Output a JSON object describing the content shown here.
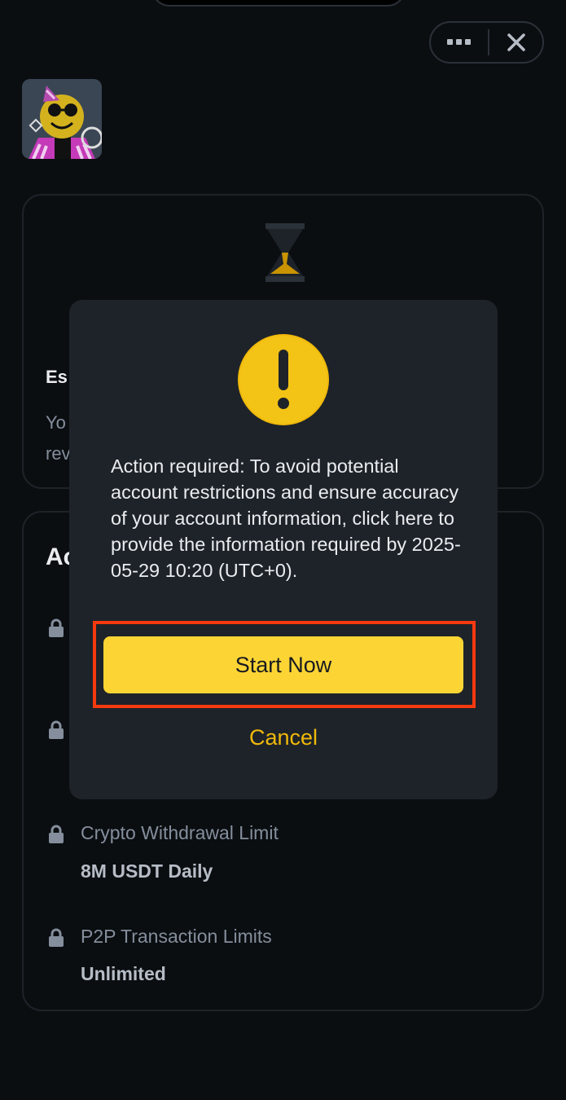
{
  "colors": {
    "background": "#0b0e11",
    "modal": "#1e2329",
    "accent_yellow": "#fcd535",
    "cancel_yellow": "#f0b90b",
    "highlight_border": "#f6390f",
    "muted_text": "#848e9c"
  },
  "topbar": {
    "more_icon": "ellipsis-icon",
    "close_icon": "close-icon"
  },
  "status_card": {
    "icon": "hourglass-icon",
    "label_partial": "Es",
    "desc_partial": "Yo\nrev"
  },
  "limits_card": {
    "title_partial": "Ac",
    "items": [
      {
        "label": "Crypto Withdrawal Limit",
        "value": "8M USDT Daily"
      },
      {
        "label": "P2P Transaction Limits",
        "value": "Unlimited"
      }
    ]
  },
  "modal": {
    "icon": "exclamation-icon",
    "message": "Action required: To avoid potential account restrictions and ensure accuracy of your account information, click here to provide the information required by 2025-05-29 10:20 (UTC+0).",
    "primary_label": "Start Now",
    "secondary_label": "Cancel"
  }
}
